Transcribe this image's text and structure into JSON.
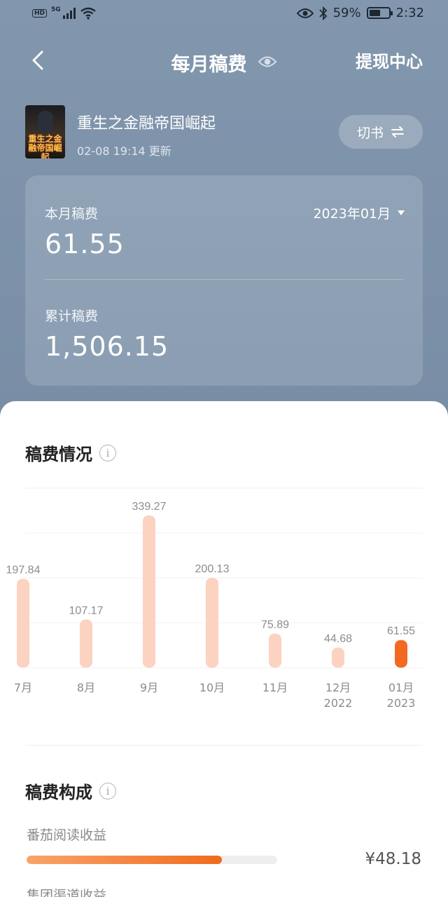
{
  "status_bar": {
    "hd": "HD",
    "network": "5G",
    "battery_percent": "59%",
    "battery_level": 0.59,
    "time": "2:32",
    "icons": [
      "signal-icon",
      "wifi-icon",
      "eye-icon",
      "bluetooth-icon",
      "battery-icon"
    ]
  },
  "header": {
    "title": "每月稿费",
    "withdraw_label": "提现中心"
  },
  "book": {
    "title": "重生之金融帝国崛起",
    "updated": "02-08 19:14 更新",
    "cover_text": "重生之金融帝国崛起",
    "switch_label": "切书"
  },
  "stats": {
    "monthly_label": "本月稿费",
    "monthly_value": "61.55",
    "month_selector": "2023年01月",
    "total_label": "累计稿费",
    "total_value": "1,506.15"
  },
  "chart_section": {
    "title": "稿费情况"
  },
  "chart_data": {
    "type": "bar",
    "categories": [
      "7月",
      "8月",
      "9月",
      "10月",
      "11月",
      "12月\n2022",
      "01月\n2023"
    ],
    "values": [
      197.84,
      107.17,
      339.27,
      200.13,
      75.89,
      44.68,
      61.55
    ],
    "value_labels": [
      "197.84",
      "107.17",
      "339.27",
      "200.13",
      "75.89",
      "44.68",
      "61.55"
    ],
    "highlight_index": 6,
    "colors": {
      "bar": "#fcd2c0",
      "highlight": "#f26a22",
      "label": "#8c8c8c",
      "grid": "#f1f1f1"
    },
    "ylim": [
      0,
      400
    ],
    "grid": true
  },
  "composition": {
    "title": "稿费构成",
    "items": [
      {
        "label": "番茄阅读收益",
        "value": "¥48.18",
        "ratio": 0.78
      },
      {
        "label": "集团渠道收益"
      }
    ]
  }
}
